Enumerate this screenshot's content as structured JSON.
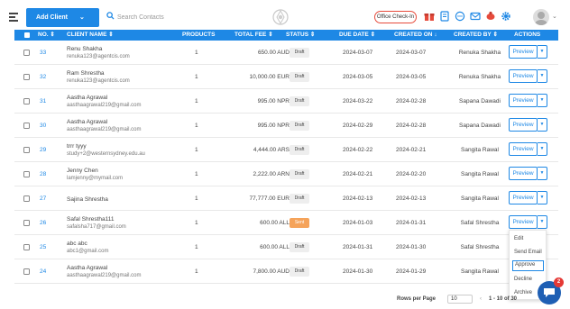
{
  "toolbar": {
    "add_client_label": "Add Client",
    "search_placeholder": "Search Contacts",
    "office_checkin_label": "Office Check-In"
  },
  "table": {
    "columns": {
      "no": "NO.",
      "client_name": "CLIENT NAME",
      "products": "PRODUCTS",
      "total_fee": "TOTAL FEE",
      "status": "STATUS",
      "due_date": "DUE DATE",
      "created_on": "CREATED ON",
      "created_by": "CREATED BY",
      "actions": "ACTIONS"
    },
    "sort_glyphs": {
      "up_down": "⇕",
      "down": "↓"
    },
    "rows": [
      {
        "no": "33",
        "name": "Renu Shakha",
        "email": "renuka123@agentcis.com",
        "products": "1",
        "fee": "650.00 AUD",
        "status": "Draft",
        "due": "2024-03-07",
        "created": "2024-03-07",
        "by": "Renuka Shakha",
        "action": "Preview"
      },
      {
        "no": "32",
        "name": "Ram Shrestha",
        "email": "renuka123@agentcis.com",
        "products": "1",
        "fee": "10,000.00 EUR",
        "status": "Draft",
        "due": "2024-03-05",
        "created": "2024-03-05",
        "by": "Renuka Shakha",
        "action": "Preview"
      },
      {
        "no": "31",
        "name": "Aastha Agrawal",
        "email": "aasthaagrawal219@gmail.com",
        "products": "1",
        "fee": "995.00 NPR",
        "status": "Draft",
        "due": "2024-03-22",
        "created": "2024-02-28",
        "by": "Sapana Dawadi",
        "action": "Preview"
      },
      {
        "no": "30",
        "name": "Aastha Agrawal",
        "email": "aasthaagrawal219@gmail.com",
        "products": "1",
        "fee": "995.00 NPR",
        "status": "Draft",
        "due": "2024-02-29",
        "created": "2024-02-28",
        "by": "Sapana Dawadi",
        "action": "Preview"
      },
      {
        "no": "29",
        "name": "trrr tyyy",
        "email": "study+2@westernsydney.edu.au",
        "products": "1",
        "fee": "4,444.00 ARS",
        "status": "Draft",
        "due": "2024-02-22",
        "created": "2024-02-21",
        "by": "Sangita Rawal",
        "action": "Preview"
      },
      {
        "no": "28",
        "name": "Jenny Chen",
        "email": "lamjenny@mymail.com",
        "products": "1",
        "fee": "2,222.00 ARN",
        "status": "Draft",
        "due": "2024-02-21",
        "created": "2024-02-20",
        "by": "Sangita Rawal",
        "action": "Preview"
      },
      {
        "no": "27",
        "name": "Sajina Shrestha",
        "email": "",
        "products": "1",
        "fee": "77,777.00 EUR",
        "status": "Draft",
        "due": "2024-02-13",
        "created": "2024-02-13",
        "by": "Sangita Rawal",
        "action": "Preview"
      },
      {
        "no": "26",
        "name": "Safal Shrestha111",
        "email": "safalsha717@gmail.com",
        "products": "1",
        "fee": "600.00 ALL",
        "status": "Sent",
        "due": "2024-01-03",
        "created": "2024-01-31",
        "by": "Safal Shrestha",
        "action": "Preview"
      },
      {
        "no": "25",
        "name": "abc abc",
        "email": "abc1@gmail.com",
        "products": "1",
        "fee": "600.00 ALL",
        "status": "Draft",
        "due": "2024-01-31",
        "created": "2024-01-30",
        "by": "Safal Shrestha",
        "action": ""
      },
      {
        "no": "24",
        "name": "Aastha Agrawal",
        "email": "aasthaagrawal219@gmail.com",
        "products": "1",
        "fee": "7,800.00 AUD",
        "status": "Draft",
        "due": "2024-01-30",
        "created": "2024-01-29",
        "by": "Sangita Rawal",
        "action": ""
      }
    ]
  },
  "dropdown": {
    "items": [
      "Edit",
      "Send Email",
      "Approve",
      "Decline",
      "Archive"
    ],
    "active_index": 2
  },
  "pagination": {
    "rows_per_page_label": "Rows per Page",
    "rows_per_page_value": "10",
    "range_text": "1 - 10 of 30"
  },
  "chat": {
    "badge_count": "2"
  },
  "colors": {
    "accent": "#1e88e5",
    "sent_status": "#f5a35a",
    "checkin_border": "#e64a3b",
    "chat": "#1e5fb4"
  },
  "icons": [
    "hamburger-icon",
    "chevron-down-icon",
    "search-icon",
    "logo-icon",
    "gift-icon",
    "document-icon",
    "chat-icon",
    "mail-icon",
    "bug-icon",
    "gear-icon",
    "avatar"
  ]
}
